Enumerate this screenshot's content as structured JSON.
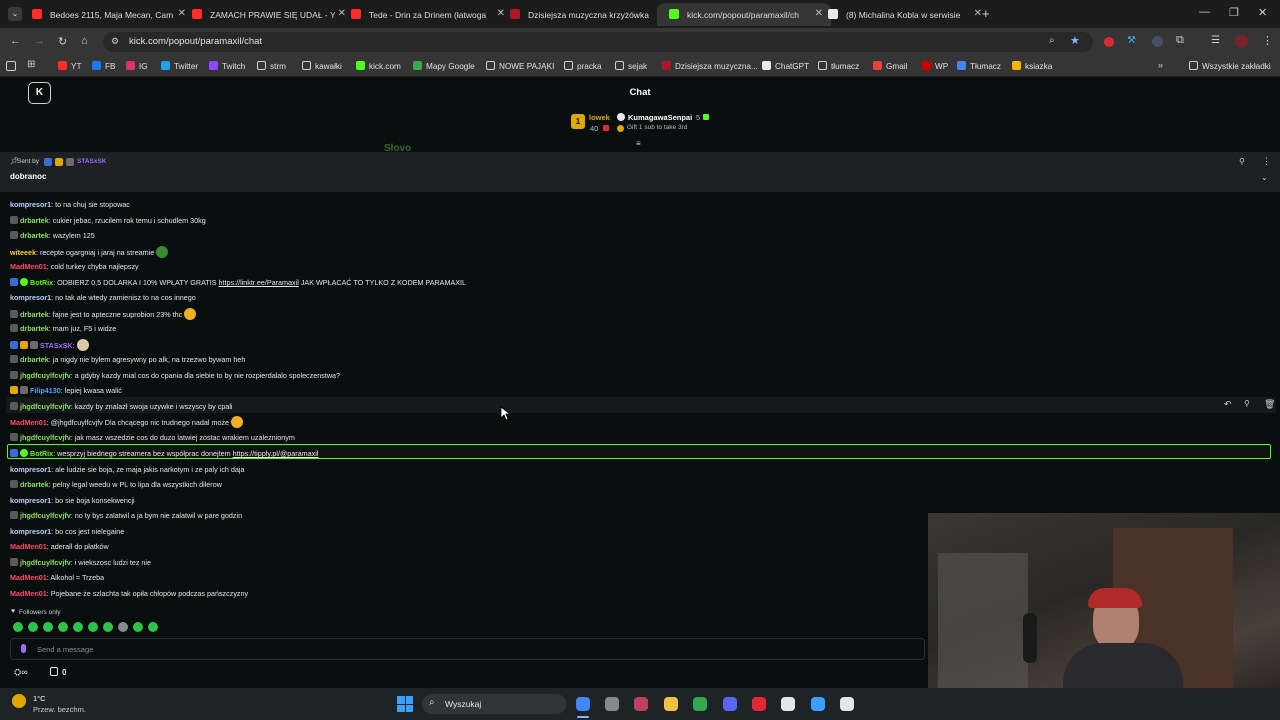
{
  "browser": {
    "tabs": [
      {
        "title": "Bedoes 2115, Maja Mecan, Cam",
        "color": "#ff2a2a"
      },
      {
        "title": "ZAMACH PRAWIE SIĘ UDAŁ - Yo",
        "color": "#ff2a2a"
      },
      {
        "title": "Tede - Drin za Drinem (łatwoga",
        "color": "#ff2a2a"
      },
      {
        "title": "Dzisiejsza muzyczna krzyżówka",
        "color": "#b0152a"
      },
      {
        "title": "kick.com/popout/paramaxil/ch",
        "color": "#53fc18"
      },
      {
        "title": "(8) Michalina Kobla w serwisie",
        "color": "#e8e8e8"
      }
    ],
    "url": "kick.com/popout/paramaxil/chat",
    "bookmarks": [
      "YT",
      "FB",
      "IG",
      "Twitter",
      "Twitch",
      "strm",
      "kawałki",
      "kick.com",
      "Mapy Google",
      "NOWE PAJĄKI",
      "pracka",
      "sejak",
      "Dzisiejsza muzyczna...",
      "ChatGPT",
      "tłumacz",
      "Gmail",
      "WP",
      "Tłumacz",
      "ksiazka"
    ],
    "all_bookmarks": "Wszystkie zakładki"
  },
  "kick": {
    "title": "Chat",
    "logo": "K",
    "gifter_rank": "1",
    "gifter_name": "lowek",
    "gifter_count": "40",
    "gifter2_name": "KumagawaSenpai",
    "gifter2_count": "5",
    "gift_cta": "Gift 1 sub to take 3rd",
    "behind_text": "Słovo",
    "pinned_sent_by": "Sent by",
    "pinned_user": "STASxSK",
    "pinned_message": "dobranoc"
  },
  "chat": [
    {
      "user": "kompresor1",
      "color": "#b8d0ff",
      "text": ": to na chuj sie stopowac"
    },
    {
      "user": "drbartek",
      "color": "#8ce05a",
      "text": ": cukier jebac, rzucilem rok temu i schudlem 30kg",
      "avatar": true
    },
    {
      "user": "drbartek",
      "color": "#8ce05a",
      "text": ": wazylem 125",
      "avatar": true
    },
    {
      "user": "witeeek",
      "color": "#ffcc33",
      "text": ": recepte ogargniaj i jaraj na streamie",
      "emote": "#3c8a2e"
    },
    {
      "user": "MadMen01",
      "color": "#ff4a6e",
      "text": ": cold turkey chyba najlepszy"
    },
    {
      "user": "BotRix",
      "color": "#53fc18",
      "text": ": ODBIERZ 0,5 DOLARKA I 10% WPŁATY GRATIS ",
      "link": "https://linktr.ee/Paramaxil",
      "after": " JAK WPŁACAĆ TO TYLKO Z KODEM PARAMAXIL",
      "bot": true
    },
    {
      "user": "kompresor1",
      "color": "#b8d0ff",
      "text": ": no tak ale wtedy zamienisz to na cos innego"
    },
    {
      "user": "drbartek",
      "color": "#8ce05a",
      "text": ": fajne jest to apteczne suprobion 23% thc",
      "avatar": true,
      "emote": "#f0b020"
    },
    {
      "user": "drbartek",
      "color": "#8ce05a",
      "text": ": mam juz, F5 i widze",
      "avatar": true
    },
    {
      "user": "STASxSK",
      "color": "#9b6cff",
      "text": ":",
      "emote": "#d8c8a8",
      "badges": true
    },
    {
      "user": "drbartek",
      "color": "#8ce05a",
      "text": ": ja nigdy nie bylem agresywny po alk, na trzezwo bywam heh",
      "avatar": true
    },
    {
      "user": "jhgdfcuylfcvjfv",
      "color": "#8ce05a",
      "text": ": a gdyby kazdy mial cos do cpania dla siebie to by nie rozpierdalalo spoleczenstwa?",
      "avatar": true
    },
    {
      "user": "Filip4130",
      "color": "#3fa8ff",
      "text": ": lepiej kwasa walić",
      "badges2": true
    },
    {
      "user": "jhgdfcuylfcvjfv",
      "color": "#8ce05a",
      "text": ": kazdy by znalazł swoja uzywke i wszyscy by cpali",
      "avatar": true,
      "hover": true
    },
    {
      "user": "MadMen01",
      "color": "#ff4a6e",
      "text": ": @jhgdfcuylfcvjfv Dla chcącego nic trudnego nadal może",
      "emote": "#f0b020"
    },
    {
      "user": "jhgdfcuylfcvjfv",
      "color": "#8ce05a",
      "text": ": jak masz wszedzie cos do duzo latwiej zostac wrakiem uzaleznionym",
      "avatar": true
    },
    {
      "user": "BotRix",
      "color": "#53fc18",
      "text": ": wesprzyj biednego streamera bez współprac donejtem ",
      "link": "https://tipply.pl/@paramaxil",
      "bot": true,
      "highlight": true
    },
    {
      "user": "kompresor1",
      "color": "#b8d0ff",
      "text": ": ale ludzie sie boja, ze maja jakis narkotym i ze paly ich daja"
    },
    {
      "user": "drbartek",
      "color": "#8ce05a",
      "text": ": pelny legal weedu w PL to lipa dla wszystkich dilerow",
      "avatar": true
    },
    {
      "user": "kompresor1",
      "color": "#b8d0ff",
      "text": ": bo sie boja konsekwencji"
    },
    {
      "user": "jhgdfcuylfcvjfv",
      "color": "#8ce05a",
      "text": ": no ty bys zalatwil a ja bym nie zalatwil w pare godzin",
      "avatar": true
    },
    {
      "user": "kompresor1",
      "color": "#b8d0ff",
      "text": ": bo cos jest nielegaine"
    },
    {
      "user": "MadMen01",
      "color": "#ff4a6e",
      "text": ": aderall do płatków"
    },
    {
      "user": "jhgdfcuylfcvjfv",
      "color": "#8ce05a",
      "text": ": i wiekszosc ludzi tez nie",
      "avatar": true
    },
    {
      "user": "MadMen01",
      "color": "#ff4a6e",
      "text": ": Alkohol = Trzeba"
    },
    {
      "user": "MadMen01",
      "color": "#ff4a6e",
      "text": ": Pojebane że szlachta tak opiła chłopów podczas pańszczyzny"
    }
  ],
  "input": {
    "followers_only": "Followers only",
    "placeholder": "Send a message",
    "points": "0"
  },
  "taskbar": {
    "temp": "1°C",
    "weather": "Przew. bezchm.",
    "search": "Wyszukaj"
  }
}
